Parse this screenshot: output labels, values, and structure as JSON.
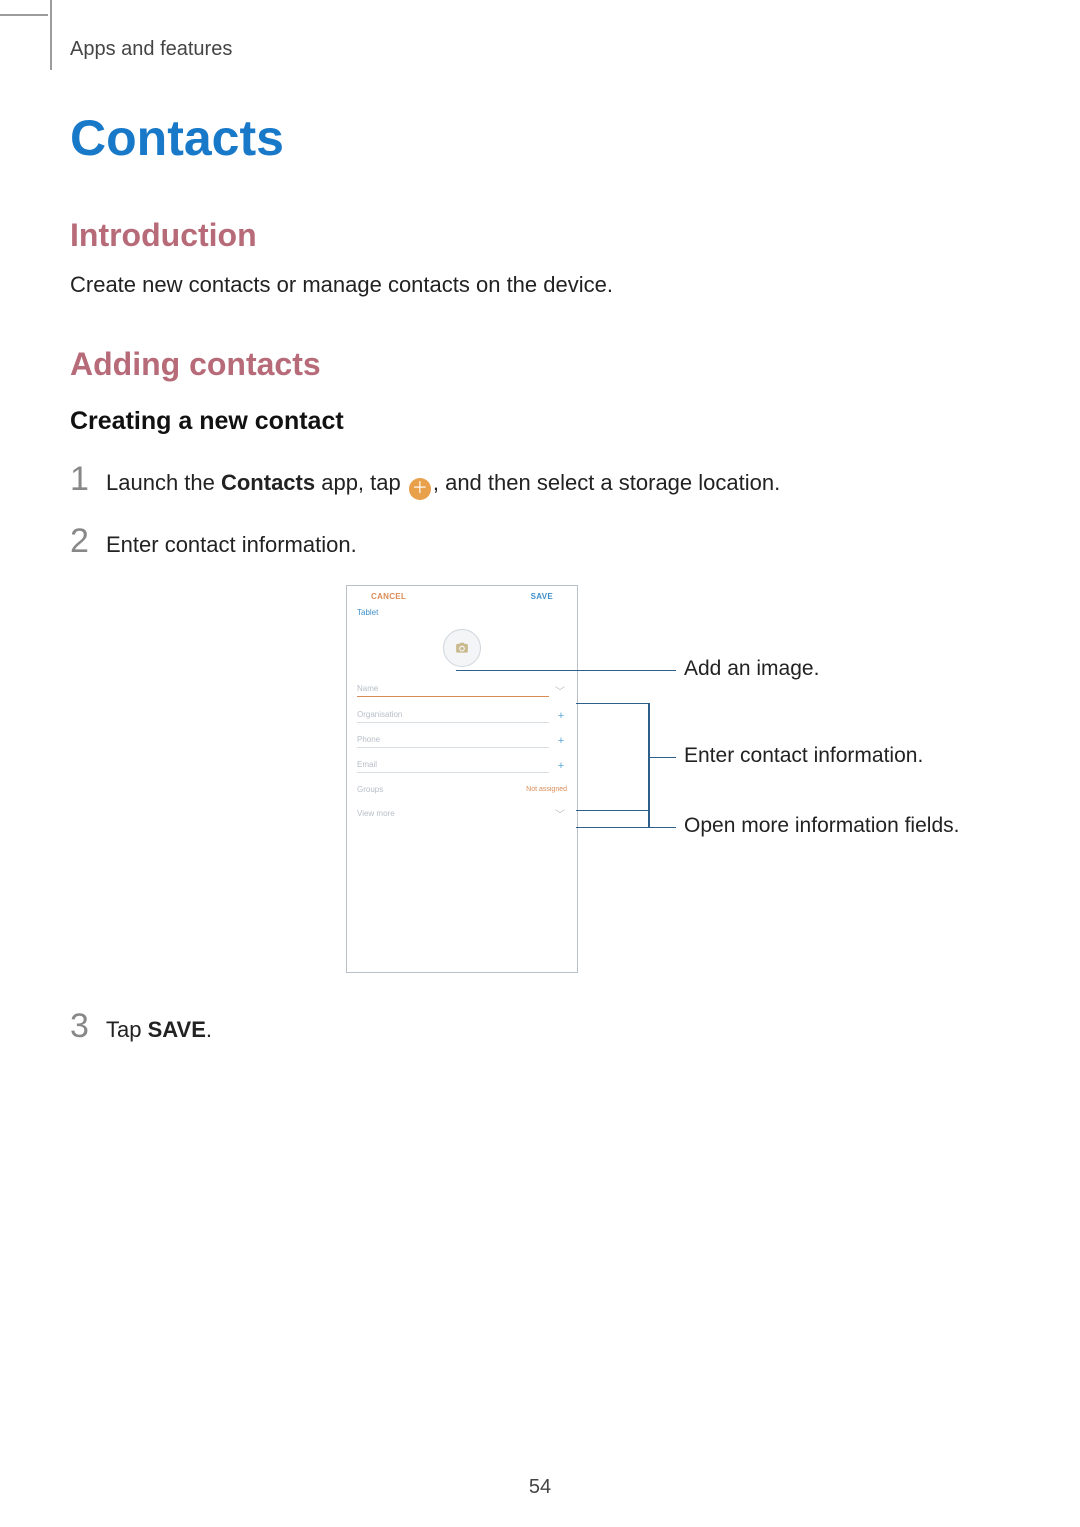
{
  "breadcrumb": "Apps and features",
  "page_title": "Contacts",
  "section_intro": {
    "heading": "Introduction",
    "text": "Create new contacts or manage contacts on the device."
  },
  "section_adding": {
    "heading": "Adding contacts",
    "subheading": "Creating a new contact"
  },
  "steps": {
    "s1_pre": "Launch the ",
    "s1_app": "Contacts",
    "s1_mid": " app, tap ",
    "s1_post": ", and then select a storage location.",
    "s2": "Enter contact information.",
    "s3_pre": "Tap ",
    "s3_bold": "SAVE",
    "s3_post": "."
  },
  "phone": {
    "cancel": "CANCEL",
    "save": "SAVE",
    "account": "Tablet",
    "fields": {
      "name": "Name",
      "organisation": "Organisation",
      "phone": "Phone",
      "email": "Email",
      "groups": "Groups",
      "groups_value": "Not assigned",
      "view_more": "View more"
    }
  },
  "callouts": {
    "add_image": "Add an image.",
    "enter_info": "Enter contact information.",
    "open_more": "Open more information fields."
  },
  "page_number": "54"
}
